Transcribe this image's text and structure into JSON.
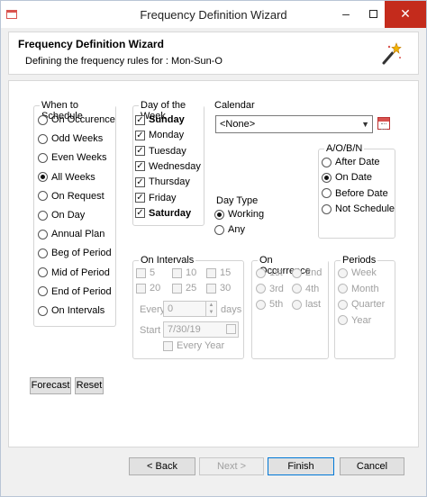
{
  "window": {
    "title": "Frequency Definition Wizard",
    "minimize_glyph": "–",
    "close_glyph": "✕"
  },
  "banner": {
    "title": "Frequency Definition Wizard",
    "subtitle_prefix": "Defining the frequency rules for :",
    "subtitle_value": "Mon-Sun-O",
    "icon": "magic-wand-icon"
  },
  "when_to_schedule": {
    "title": "When to Schedule",
    "options": [
      {
        "label": "On Occurence",
        "selected": false
      },
      {
        "label": "Odd Weeks",
        "selected": false
      },
      {
        "label": "Even Weeks",
        "selected": false
      },
      {
        "label": "All Weeks",
        "selected": true
      },
      {
        "label": "On Request",
        "selected": false
      },
      {
        "label": "On Day",
        "selected": false
      },
      {
        "label": "Annual Plan",
        "selected": false
      },
      {
        "label": "Beg of Period",
        "selected": false
      },
      {
        "label": "Mid of Period",
        "selected": false
      },
      {
        "label": "End of Period",
        "selected": false
      },
      {
        "label": "On Intervals",
        "selected": false
      }
    ]
  },
  "day_of_week": {
    "title": "Day of the Week",
    "days": [
      {
        "label": "Sunday",
        "checked": true,
        "bold": true
      },
      {
        "label": "Monday",
        "checked": true,
        "bold": false
      },
      {
        "label": "Tuesday",
        "checked": true,
        "bold": false
      },
      {
        "label": "Wednesday",
        "checked": true,
        "bold": false
      },
      {
        "label": "Thursday",
        "checked": true,
        "bold": false
      },
      {
        "label": "Friday",
        "checked": true,
        "bold": false
      },
      {
        "label": "Saturday",
        "checked": true,
        "bold": true
      }
    ]
  },
  "calendar": {
    "title": "Calendar",
    "selected": "<None>",
    "icon": "calendar-icon"
  },
  "aobn": {
    "title": "A/O/B/N",
    "options": [
      {
        "label": "After Date",
        "selected": false
      },
      {
        "label": "On Date",
        "selected": true
      },
      {
        "label": "Before Date",
        "selected": false
      },
      {
        "label": "Not Schedule",
        "selected": false
      }
    ]
  },
  "day_type": {
    "title": "Day Type",
    "options": [
      {
        "label": "Working",
        "selected": true
      },
      {
        "label": "Any",
        "selected": false
      }
    ]
  },
  "on_intervals": {
    "title": "On Intervals",
    "values": [
      "5",
      "10",
      "15",
      "20",
      "25",
      "30"
    ],
    "every_label": "Every",
    "every_value": "0",
    "days_label": "days",
    "start_label": "Start",
    "start_value": "7/30/19",
    "every_year_label": "Every Year"
  },
  "on_occurrence": {
    "title": "On Occurrence",
    "options": [
      "1st",
      "2nd",
      "3rd",
      "4th",
      "5th",
      "last"
    ]
  },
  "periods": {
    "title": "Periods",
    "options": [
      "Week",
      "Month",
      "Quarter",
      "Year"
    ]
  },
  "actions": {
    "forecast": "Forecast",
    "reset": "Reset"
  },
  "footer": {
    "back": "< Back",
    "next": "Next >",
    "finish": "Finish",
    "cancel": "Cancel"
  }
}
